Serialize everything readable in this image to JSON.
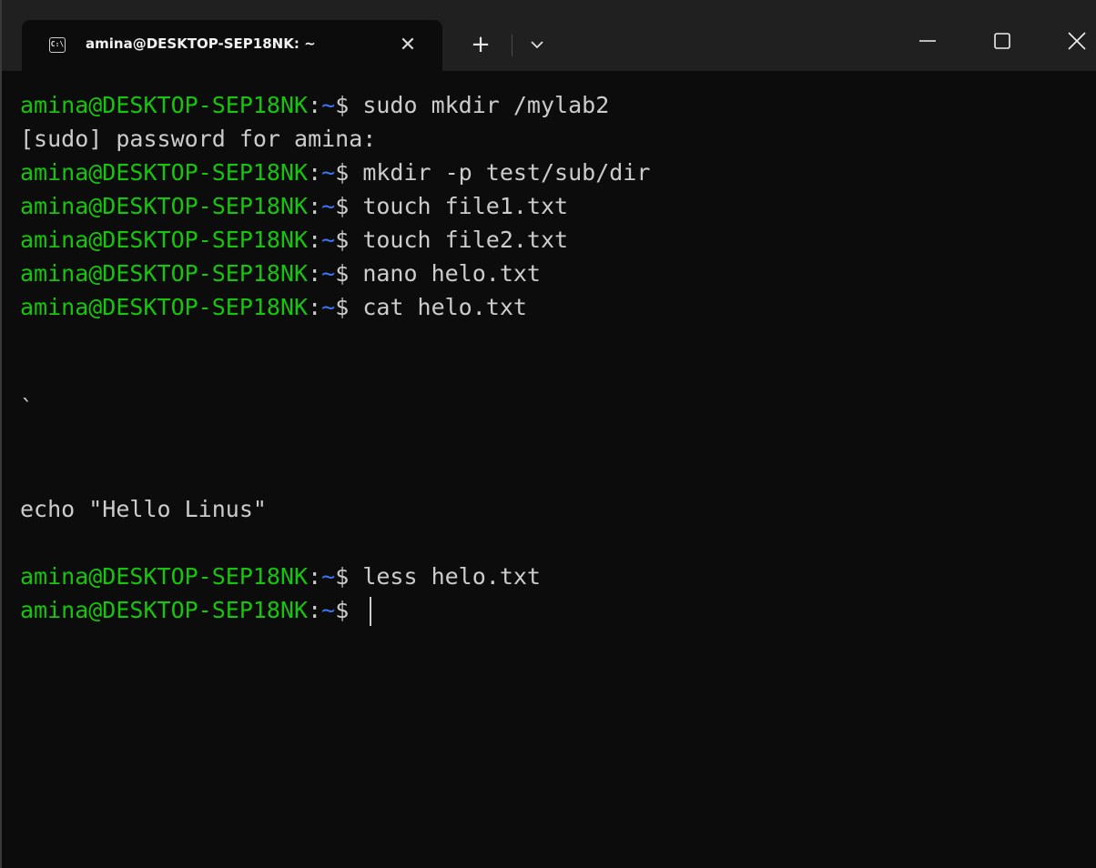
{
  "tab": {
    "title": "amina@DESKTOP-SEP18NK: ~",
    "icon": "terminal-icon",
    "close": "✕"
  },
  "toolbar": {
    "new_tab": "+",
    "dropdown_icon": "chevron-down-icon"
  },
  "window_controls": [
    "minimize-icon",
    "maximize-icon",
    "close-icon"
  ],
  "colors": {
    "background": "#0c0c0c",
    "titlebar": "#202020",
    "prompt_user": "#16c60c",
    "prompt_path": "#3b78ff",
    "text": "#cccccc"
  },
  "prompt": {
    "user": "amina@DESKTOP-SEP18NK",
    "colon": ":",
    "path": "~",
    "symbol": "$"
  },
  "lines": [
    {
      "type": "cmd",
      "text": " sudo mkdir /mylab2"
    },
    {
      "type": "out",
      "text": "[sudo] password for amina:"
    },
    {
      "type": "cmd",
      "text": " mkdir -p test/sub/dir"
    },
    {
      "type": "cmd",
      "text": " touch file1.txt"
    },
    {
      "type": "cmd",
      "text": " touch file2.txt"
    },
    {
      "type": "cmd",
      "text": " nano helo.txt"
    },
    {
      "type": "cmd",
      "text": " cat helo.txt"
    },
    {
      "type": "out",
      "text": ""
    },
    {
      "type": "out",
      "text": ""
    },
    {
      "type": "out",
      "text": "`"
    },
    {
      "type": "out",
      "text": ""
    },
    {
      "type": "out",
      "text": ""
    },
    {
      "type": "out",
      "text": "echo \"Hello Linus\""
    },
    {
      "type": "out",
      "text": ""
    },
    {
      "type": "cmd",
      "text": " less helo.txt"
    },
    {
      "type": "cmd",
      "text": " ",
      "cursor": true
    }
  ]
}
